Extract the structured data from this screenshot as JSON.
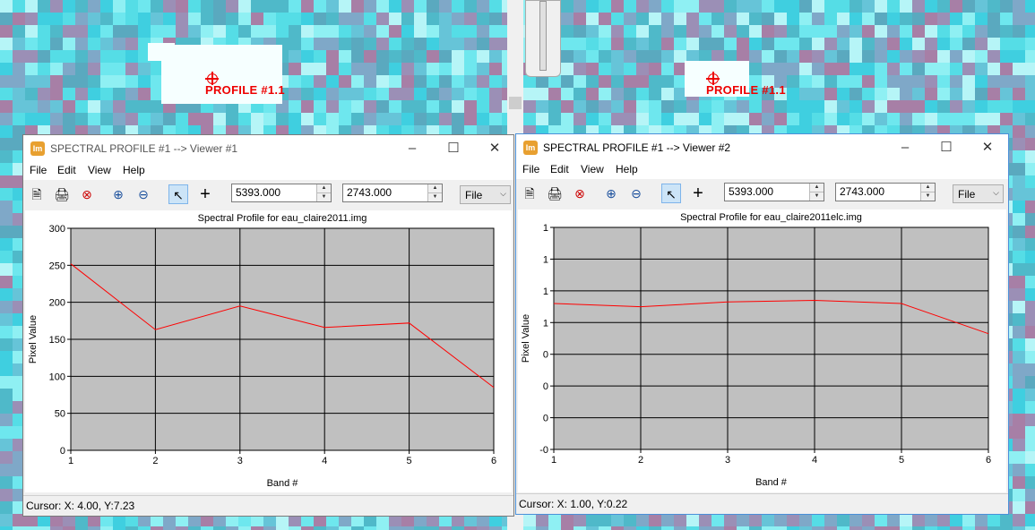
{
  "background": {
    "left_profile_label": "PROFILE #1.1",
    "right_profile_label": "PROFILE #1.1"
  },
  "windows": [
    {
      "title": "SPECTRAL PROFILE #1 --> Viewer #1",
      "active": false,
      "menu": [
        "File",
        "Edit",
        "View",
        "Help"
      ],
      "x_value": "5393.000",
      "y_value": "2743.000",
      "select_value": "File",
      "status": "Cursor: X: 4.00, Y:7.23",
      "icons": [
        "new-document-icon",
        "print-icon",
        "clear-icon",
        "zoom-in-icon",
        "zoom-out-icon",
        "select-arrow-icon",
        "crosshair-icon"
      ],
      "chart_data": {
        "type": "line",
        "title": "Spectral Profile for eau_claire2011.img",
        "xlabel": "Band #",
        "ylabel": "Pixel Value",
        "x": [
          1,
          2,
          3,
          4,
          5,
          6
        ],
        "x_ticks": [
          "1",
          "2",
          "3",
          "4",
          "5",
          "6"
        ],
        "y_ticks": [
          "0",
          "50",
          "100",
          "150",
          "200",
          "250",
          "300"
        ],
        "xlim": [
          1,
          6
        ],
        "ylim": [
          0,
          300
        ],
        "grid": true,
        "series": [
          {
            "values": [
              252,
              163,
              195,
              166,
              172,
              85
            ],
            "color": "#ff0000"
          }
        ]
      }
    },
    {
      "title": "SPECTRAL PROFILE #1 --> Viewer #2",
      "active": true,
      "menu": [
        "File",
        "Edit",
        "View",
        "Help"
      ],
      "x_value": "5393.000",
      "y_value": "2743.000",
      "select_value": "File",
      "status": "Cursor: X: 1.00, Y:0.22",
      "icons": [
        "new-document-icon",
        "print-icon",
        "clear-icon",
        "zoom-in-icon",
        "zoom-out-icon",
        "select-arrow-icon",
        "crosshair-icon"
      ],
      "chart_data": {
        "type": "line",
        "title": "Spectral Profile for eau_claire2011elc.img",
        "xlabel": "Band #",
        "ylabel": "Pixel Value",
        "x": [
          1,
          2,
          3,
          4,
          5,
          6
        ],
        "x_ticks": [
          "1",
          "2",
          "3",
          "4",
          "5",
          "6"
        ],
        "y_ticks": [
          "-0",
          "0",
          "0",
          "0",
          "1",
          "1",
          "1",
          "1"
        ],
        "xlim": [
          1,
          6
        ],
        "ylim": [
          -0.2,
          1.2
        ],
        "grid": true,
        "series": [
          {
            "values": [
              0.72,
              0.7,
              0.73,
              0.74,
              0.72,
              0.53
            ],
            "color": "#ff0000"
          }
        ]
      }
    }
  ]
}
